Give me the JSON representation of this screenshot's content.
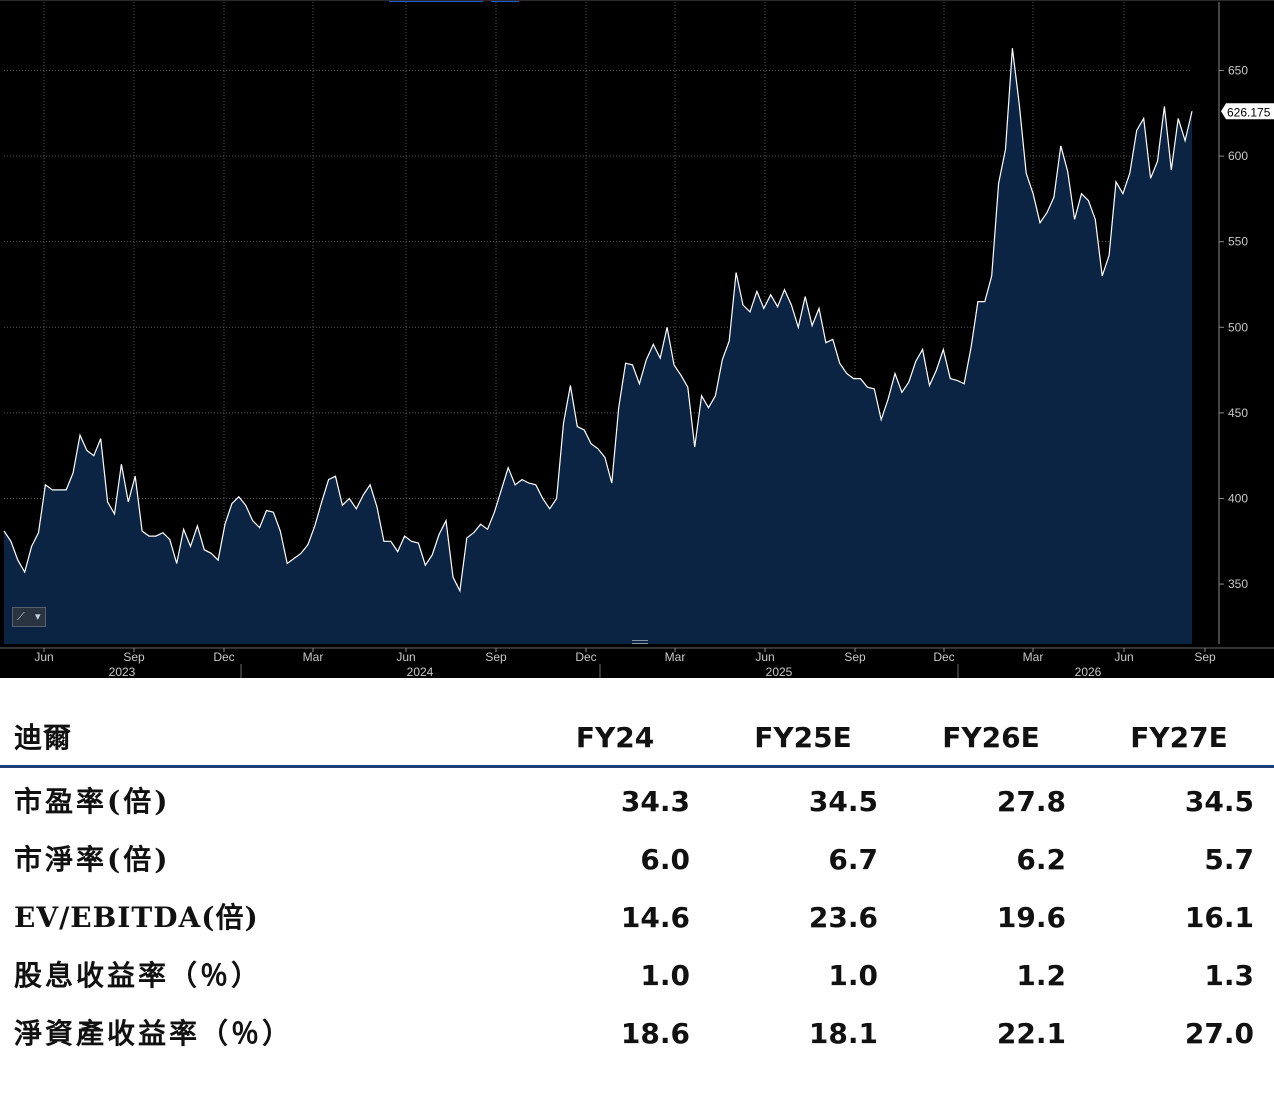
{
  "chart_data": {
    "type": "area",
    "last_value_label": "626.175",
    "y_ticks": [
      350,
      400,
      450,
      500,
      550,
      600,
      650
    ],
    "ylim": [
      315,
      690
    ],
    "grid": true,
    "colors": {
      "background": "#000000",
      "fill": "#0b2443",
      "line": "#ffffff",
      "grid": "#555555",
      "axis_text": "#c8c8c8"
    },
    "x_month_labels": [
      {
        "label": "Jun",
        "date": "2023-06"
      },
      {
        "label": "Sep",
        "date": "2023-09"
      },
      {
        "label": "Dec",
        "date": "2023-12"
      },
      {
        "label": "Mar",
        "date": "2024-03"
      },
      {
        "label": "Jun",
        "date": "2024-06"
      },
      {
        "label": "Sep",
        "date": "2024-09"
      },
      {
        "label": "Dec",
        "date": "2024-12"
      },
      {
        "label": "Mar",
        "date": "2025-03"
      },
      {
        "label": "Jun",
        "date": "2025-06"
      },
      {
        "label": "Sep",
        "date": "2025-09"
      },
      {
        "label": "Dec",
        "date": "2025-12"
      },
      {
        "label": "Mar",
        "date": "2026-03"
      },
      {
        "label": "Jun",
        "date": "2026-06"
      },
      {
        "label": "Sep",
        "date": "2026-09"
      }
    ],
    "x_year_labels": [
      "2023",
      "2024",
      "2025",
      "2026"
    ],
    "values": [
      381,
      375,
      364,
      357,
      372,
      380,
      408,
      405,
      405,
      405,
      415,
      437,
      428,
      425,
      435,
      398,
      391,
      420,
      398,
      413,
      381,
      378,
      378,
      380,
      376,
      362,
      382,
      372,
      384,
      370,
      368,
      364,
      385,
      397,
      401,
      396,
      387,
      383,
      393,
      392,
      381,
      362,
      365,
      368,
      373,
      384,
      398,
      411,
      413,
      396,
      400,
      394,
      402,
      408,
      395,
      375,
      375,
      369,
      378,
      375,
      374,
      361,
      367,
      379,
      387,
      354,
      346,
      377,
      380,
      385,
      382,
      392,
      405,
      418,
      408,
      411,
      409,
      408,
      400,
      394,
      400,
      444,
      466,
      442,
      440,
      432,
      429,
      424,
      409,
      453,
      479,
      478,
      467,
      481,
      490,
      482,
      500,
      478,
      472,
      465,
      430,
      460,
      453,
      460,
      481,
      492,
      532,
      513,
      509,
      521,
      511,
      519,
      512,
      522,
      513,
      500,
      518,
      501,
      511,
      491,
      493,
      479,
      473,
      470,
      470,
      465,
      464,
      446,
      458,
      473,
      462,
      468,
      480,
      487,
      466,
      475,
      487,
      470,
      469,
      467,
      488,
      515,
      515,
      530,
      584,
      604,
      663,
      630,
      590,
      578,
      561,
      567,
      576,
      606,
      591,
      563,
      578,
      574,
      563,
      530,
      542,
      585,
      578,
      590,
      615,
      622,
      587,
      597,
      629,
      592,
      622,
      609,
      626.175
    ]
  },
  "table": {
    "company": "迪爾",
    "years": [
      "FY24",
      "FY25E",
      "FY26E",
      "FY27E"
    ],
    "rows": [
      {
        "label": "市盈率(倍)",
        "values": [
          "34.3",
          "34.5",
          "27.8",
          "34.5"
        ]
      },
      {
        "label": "市淨率(倍)",
        "values": [
          "6.0",
          "6.7",
          "6.2",
          "5.7"
        ]
      },
      {
        "label": "EV/EBITDA(倍)",
        "values": [
          "14.6",
          "23.6",
          "19.6",
          "16.1"
        ]
      },
      {
        "label": "股息收益率（％）",
        "values": [
          "1.0",
          "1.0",
          "1.2",
          "1.3"
        ]
      },
      {
        "label": "淨資產收益率（％）",
        "values": [
          "18.6",
          "18.1",
          "22.1",
          "27.0"
        ]
      }
    ]
  }
}
